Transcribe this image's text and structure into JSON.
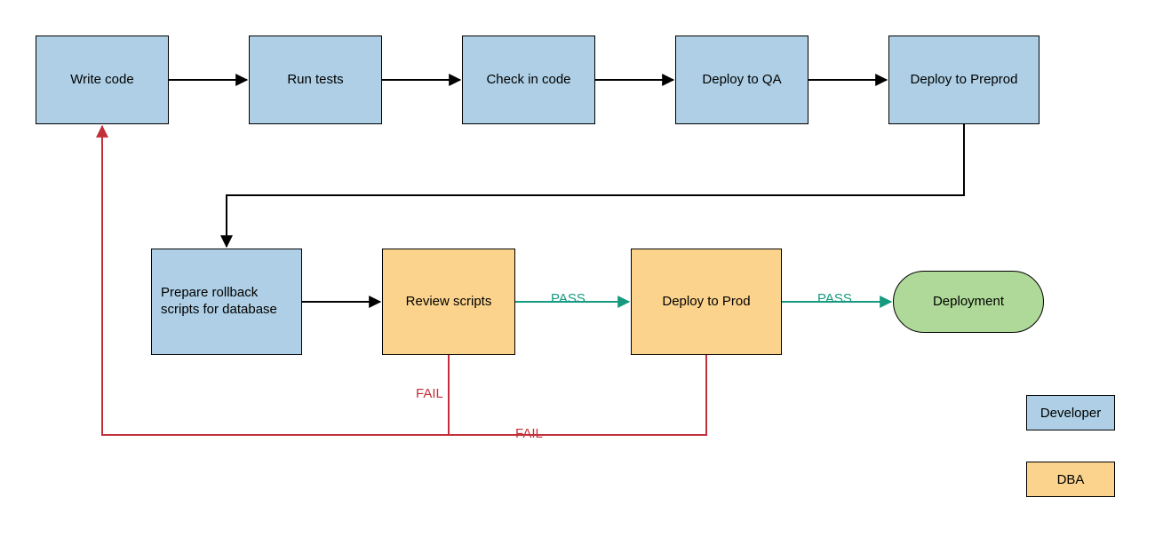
{
  "nodes": {
    "write_code": "Write code",
    "run_tests": "Run tests",
    "check_in": "Check in code",
    "deploy_qa": "Deploy to QA",
    "deploy_preprod": "Deploy to Preprod",
    "prepare_rollback": "Prepare rollback scripts for database",
    "review_scripts": "Review scripts",
    "deploy_prod": "Deploy to Prod",
    "deployment": "Deployment"
  },
  "edge_labels": {
    "review_pass": "PASS",
    "prod_pass": "PASS",
    "review_fail": "FAIL",
    "prod_fail": "FAIL"
  },
  "legend": {
    "developer": "Developer",
    "dba": "DBA"
  },
  "colors": {
    "developer": "#aecfe5",
    "dba": "#fbd38d",
    "terminal": "#afd998",
    "edge": "#000000",
    "pass": "#159a80",
    "fail": "#c22f3a"
  },
  "chart_data": {
    "type": "flowchart",
    "legend": [
      {
        "label": "Developer",
        "color": "#aecfe5"
      },
      {
        "label": "DBA",
        "color": "#fbd38d"
      }
    ],
    "nodes": [
      {
        "id": "write_code",
        "label": "Write code",
        "role": "Developer",
        "shape": "rect"
      },
      {
        "id": "run_tests",
        "label": "Run tests",
        "role": "Developer",
        "shape": "rect"
      },
      {
        "id": "check_in",
        "label": "Check in code",
        "role": "Developer",
        "shape": "rect"
      },
      {
        "id": "deploy_qa",
        "label": "Deploy to QA",
        "role": "Developer",
        "shape": "rect"
      },
      {
        "id": "deploy_preprod",
        "label": "Deploy to Preprod",
        "role": "Developer",
        "shape": "rect"
      },
      {
        "id": "prepare_rollback",
        "label": "Prepare rollback scripts for database",
        "role": "Developer",
        "shape": "rect"
      },
      {
        "id": "review_scripts",
        "label": "Review scripts",
        "role": "DBA",
        "shape": "rect"
      },
      {
        "id": "deploy_prod",
        "label": "Deploy to Prod",
        "role": "DBA",
        "shape": "rect"
      },
      {
        "id": "deployment",
        "label": "Deployment",
        "role": "Terminal",
        "shape": "rounded"
      }
    ],
    "edges": [
      {
        "from": "write_code",
        "to": "run_tests"
      },
      {
        "from": "run_tests",
        "to": "check_in"
      },
      {
        "from": "check_in",
        "to": "deploy_qa"
      },
      {
        "from": "deploy_qa",
        "to": "deploy_preprod"
      },
      {
        "from": "deploy_preprod",
        "to": "prepare_rollback"
      },
      {
        "from": "prepare_rollback",
        "to": "review_scripts"
      },
      {
        "from": "review_scripts",
        "to": "deploy_prod",
        "label": "PASS",
        "condition": "pass"
      },
      {
        "from": "deploy_prod",
        "to": "deployment",
        "label": "PASS",
        "condition": "pass"
      },
      {
        "from": "review_scripts",
        "to": "write_code",
        "label": "FAIL",
        "condition": "fail"
      },
      {
        "from": "deploy_prod",
        "to": "write_code",
        "label": "FAIL",
        "condition": "fail"
      }
    ]
  }
}
